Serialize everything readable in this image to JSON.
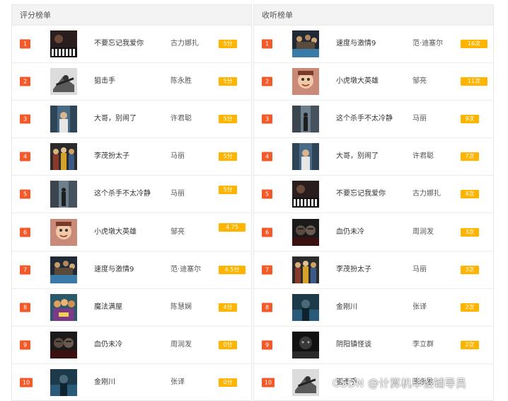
{
  "left_panel": {
    "title": "评分榜单",
    "rows": [
      {
        "rank": "1",
        "title": "不要忘记我爱你",
        "artist": "古力娜扎",
        "badge": "5分",
        "cover": "cover-piano"
      },
      {
        "rank": "2",
        "title": "狙击手",
        "artist": "陈永胜",
        "badge": "5分",
        "cover": "cover-sniper"
      },
      {
        "rank": "3",
        "title": "大哥，别闹了",
        "artist": "许君聪",
        "badge": "5分",
        "cover": "cover-city"
      },
      {
        "rank": "4",
        "title": "李茂扮太子",
        "artist": "马丽",
        "badge": "5分",
        "cover": "cover-group"
      },
      {
        "rank": "5",
        "title": "这个杀手不太冷静",
        "artist": "马丽",
        "badge": "5分",
        "cover": "cover-street"
      },
      {
        "rank": "6",
        "title": "小虎墩大英雄",
        "artist": "邹亮",
        "badge": "4.75",
        "cover": "cover-cartoon"
      },
      {
        "rank": "7",
        "title": "速度与激情9",
        "artist": "范·迪塞尔",
        "badge": "4.5分",
        "cover": "cover-action"
      },
      {
        "rank": "8",
        "title": "魔法满屋",
        "artist": "陈慧娴",
        "badge": "4分",
        "cover": "cover-magic"
      },
      {
        "rank": "9",
        "title": "血仍未冷",
        "artist": "周润发",
        "badge": "0分",
        "cover": "cover-blood"
      },
      {
        "rank": "10",
        "title": "金刚川",
        "artist": "张译",
        "badge": "0分",
        "cover": "cover-river"
      }
    ]
  },
  "right_panel": {
    "title": "收听榜单",
    "rows": [
      {
        "rank": "1",
        "title": "速度与激情9",
        "artist": "范·迪塞尔",
        "badge": "16次",
        "cover": "cover-action"
      },
      {
        "rank": "2",
        "title": "小虎墩大英雄",
        "artist": "邹亮",
        "badge": "11次",
        "cover": "cover-cartoon"
      },
      {
        "rank": "3",
        "title": "这个杀手不太冷静",
        "artist": "马丽",
        "badge": "9次",
        "cover": "cover-street"
      },
      {
        "rank": "4",
        "title": "大哥，别闹了",
        "artist": "许君聪",
        "badge": "7次",
        "cover": "cover-city"
      },
      {
        "rank": "5",
        "title": "不要忘记我爱你",
        "artist": "古力娜扎",
        "badge": "4次",
        "cover": "cover-piano"
      },
      {
        "rank": "6",
        "title": "血仍未冷",
        "artist": "周润发",
        "badge": "3次",
        "cover": "cover-blood"
      },
      {
        "rank": "7",
        "title": "李茂扮太子",
        "artist": "马丽",
        "badge": "3次",
        "cover": "cover-group"
      },
      {
        "rank": "8",
        "title": "金刚川",
        "artist": "张译",
        "badge": "2次",
        "cover": "cover-river"
      },
      {
        "rank": "9",
        "title": "阴阳镇怪谈",
        "artist": "李立群",
        "badge": "2次",
        "cover": "cover-town"
      },
      {
        "rank": "10",
        "title": "狙击手",
        "artist": "陈永胜",
        "badge": "",
        "cover": "cover-sniper"
      }
    ]
  },
  "watermark": "CSDN @计算机毕设辅导员",
  "colors": {
    "rank_badge": "#f25a2a",
    "score_badge": "#ffb400",
    "header_bg": "#f3f3f3"
  }
}
